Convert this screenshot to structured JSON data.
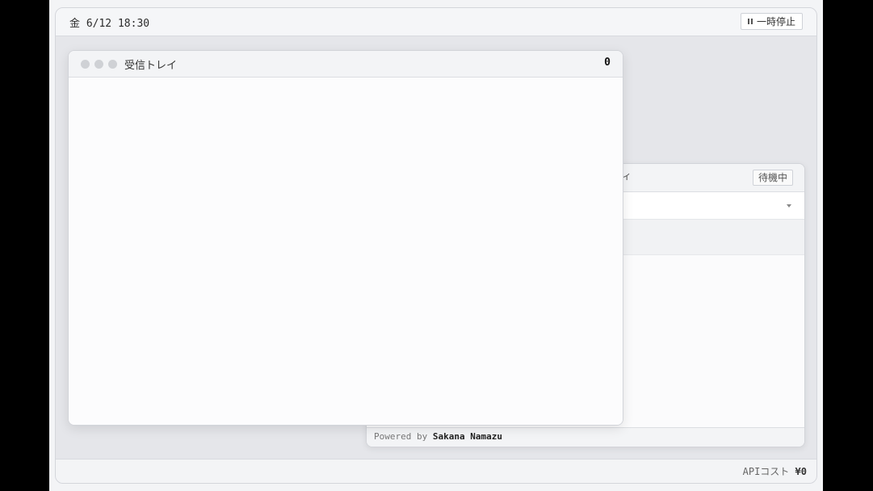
{
  "topbar": {
    "clock": "金 6/12 18:30",
    "pause_label": "一時停止"
  },
  "back_window": {
    "title_fragment": "ィ",
    "status": "待機中",
    "footer_prefix": "Powered by",
    "footer_brand": "Sakana Namazu"
  },
  "inbox_window": {
    "title": "受信トレイ",
    "count": "0"
  },
  "bottombar": {
    "cost_label": "APIコスト",
    "cost_value": "¥0"
  },
  "icons": {
    "pause": "pause-icon",
    "dropdown": "chevron-down-icon",
    "window_controls": "traffic-light-icon"
  }
}
